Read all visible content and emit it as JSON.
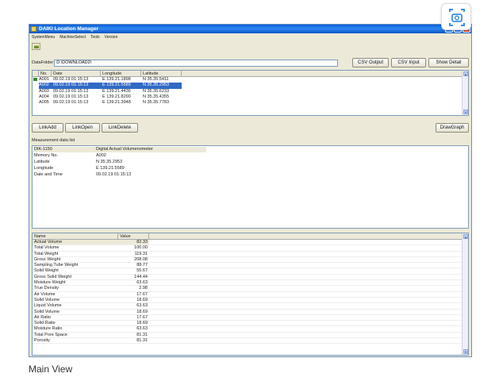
{
  "window": {
    "title": "DAIKI Location Manager"
  },
  "menu": [
    "SystemMenu",
    "MachineSelect",
    "Tools",
    "Version"
  ],
  "folder": {
    "label": "DataFolder",
    "value": "D:\\DOWNLOAD2\\"
  },
  "buttons": {
    "csv_output": "CSV Output",
    "csv_input": "CSV Input",
    "show_detail": "Show Detail",
    "link_add": "LinkAdd",
    "link_open": "LinkOpen",
    "link_delete": "LinkDelete",
    "draw_graph": "DrawGraph"
  },
  "records": {
    "columns": [
      "No.",
      "Date",
      "Longitude",
      "Latitude"
    ],
    "rows": [
      {
        "no": "A001",
        "date": "09.02.19 01:15:13",
        "lon": "E 139.21.1898",
        "lat": "N 35.35.5411",
        "marked": true
      },
      {
        "no": "A002",
        "date": "09.02.19 01:15:13",
        "lon": "E 139.21.5589",
        "lat": "N 35.35.2953",
        "selected": true
      },
      {
        "no": "A003",
        "date": "09.02.19 01:15:13",
        "lon": "E 139.21.4436",
        "lat": "N 35.35.6233"
      },
      {
        "no": "A004",
        "date": "09.02.19 01:15:13",
        "lon": "E 139.21.8290",
        "lat": "N 35.35.4355"
      },
      {
        "no": "A005",
        "date": "09.02.19 01:15:13",
        "lon": "E 139.21.3948",
        "lat": "N 35.35.7783"
      }
    ]
  },
  "measurement": {
    "section_label": "Measurement data list",
    "device_id": "DIK-1150",
    "device_name": "Digital Actual Volumenometer",
    "fields": [
      {
        "k": "Memory No.",
        "v": "A002"
      },
      {
        "k": "Latitude",
        "v": "N 35.35.2953"
      },
      {
        "k": "Longitude",
        "v": "E 139.21.5589"
      },
      {
        "k": "Date and Time",
        "v": "09.02.19 01:15:13"
      }
    ]
  },
  "values": {
    "columns": [
      "Name",
      "Value"
    ],
    "rows": [
      {
        "name": "Actual Volume",
        "value": "82.33"
      },
      {
        "name": "Total Volume",
        "value": "100.00"
      },
      {
        "name": "Total Weight",
        "value": "119.31"
      },
      {
        "name": "Gross Weight",
        "value": "208.08"
      },
      {
        "name": "Sampling Tube Weight",
        "value": "88.77"
      },
      {
        "name": "Solid Weight",
        "value": "55.67"
      },
      {
        "name": "Gross Solid Weight",
        "value": "144.44"
      },
      {
        "name": "Moisture Weight",
        "value": "63.63"
      },
      {
        "name": "True Density",
        "value": "2.98"
      },
      {
        "name": "Air Volume",
        "value": "17.67"
      },
      {
        "name": "Solid Volume",
        "value": "18.69"
      },
      {
        "name": "Liquid Volume",
        "value": "63.63"
      },
      {
        "name": "Solid Volume",
        "value": "18.69"
      },
      {
        "name": "Air Ratio",
        "value": "17.67"
      },
      {
        "name": "Solid Ratio",
        "value": "18.69"
      },
      {
        "name": "Moisture Ratio",
        "value": "63.63"
      },
      {
        "name": "Total Pore Space",
        "value": "81.31"
      },
      {
        "name": "Porosity",
        "value": "81.31"
      }
    ]
  },
  "caption": "Main View",
  "icons": {
    "app": "app-icon",
    "folder": "folder-open-icon",
    "camera": "camera-scan-icon"
  }
}
